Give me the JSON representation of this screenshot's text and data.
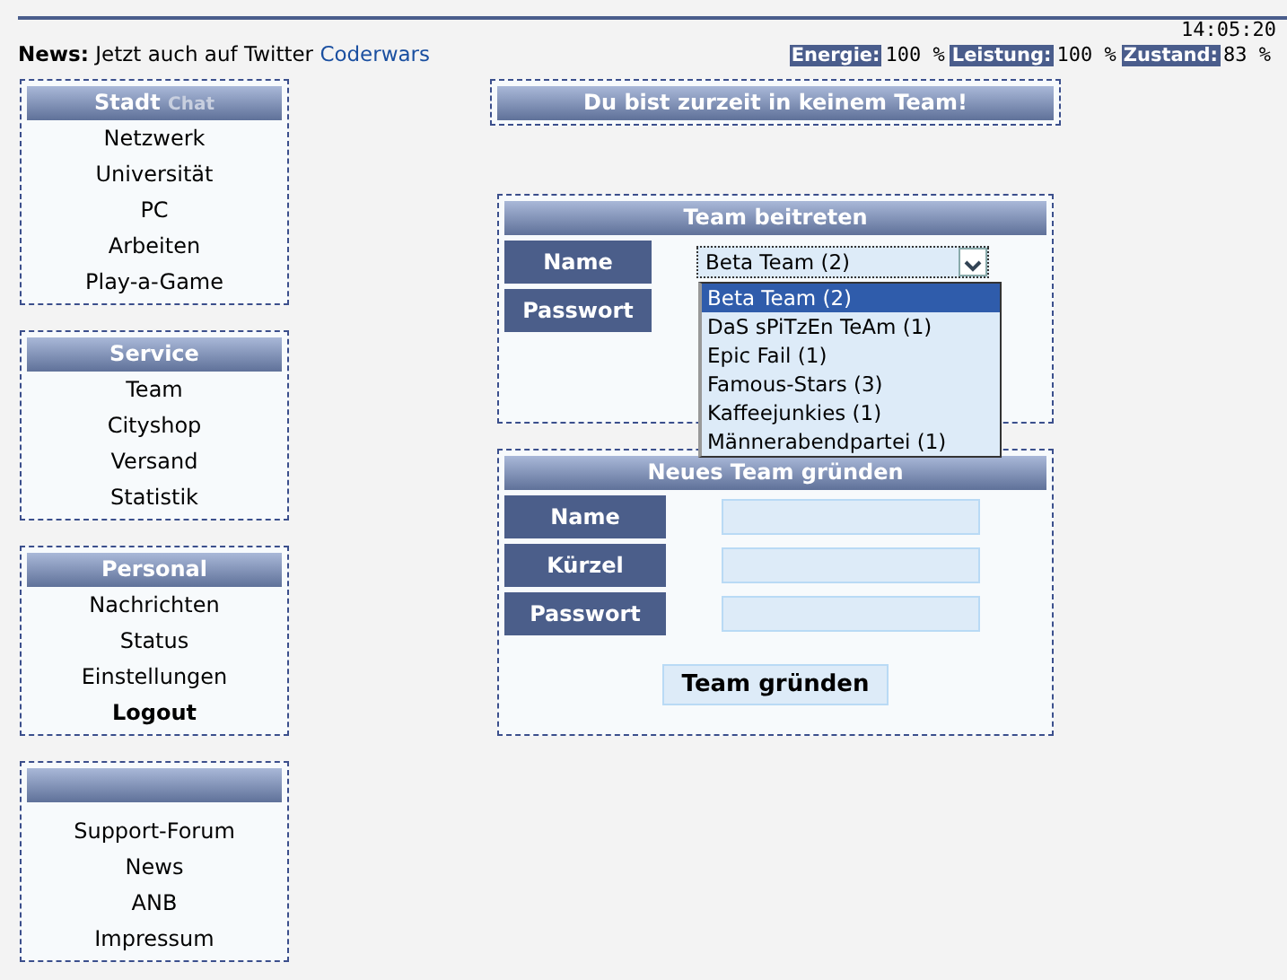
{
  "clock": "14:05:20",
  "news": {
    "label": "News:",
    "text": "Jetzt auch auf Twitter",
    "link": "Coderwars"
  },
  "stats": [
    {
      "label": "Energie:",
      "value": "100 %"
    },
    {
      "label": "Leistung:",
      "value": "100 %"
    },
    {
      "label": "Zustand:",
      "value": "83 %"
    }
  ],
  "sidebar": [
    {
      "title": "Stadt",
      "title_extra": "Chat",
      "items": [
        {
          "label": "Netzwerk",
          "bold": false
        },
        {
          "label": "Universität",
          "bold": false
        },
        {
          "label": "PC",
          "bold": false
        },
        {
          "label": "Arbeiten",
          "bold": false
        },
        {
          "label": "Play-a-Game",
          "bold": false
        }
      ]
    },
    {
      "title": "Service",
      "items": [
        {
          "label": "Team",
          "bold": false
        },
        {
          "label": "Cityshop",
          "bold": false
        },
        {
          "label": "Versand",
          "bold": false
        },
        {
          "label": "Statistik",
          "bold": false
        }
      ]
    },
    {
      "title": "Personal",
      "items": [
        {
          "label": "Nachrichten",
          "bold": false
        },
        {
          "label": "Status",
          "bold": false
        },
        {
          "label": "Einstellungen",
          "bold": false
        },
        {
          "label": "Logout",
          "bold": true
        }
      ]
    },
    {
      "items": [
        {
          "label": "Support-Forum",
          "bold": false
        },
        {
          "label": "News",
          "bold": false
        },
        {
          "label": "ANB",
          "bold": false
        },
        {
          "label": "Impressum",
          "bold": false
        }
      ]
    }
  ],
  "status_heading": "Du bist zurzeit in keinem Team!",
  "join": {
    "title": "Team beitreten",
    "name_label": "Name",
    "password_label": "Passwort",
    "team_select": {
      "value": "Beta Team (2)",
      "expanded": true,
      "options": [
        {
          "label": "Beta Team (2)",
          "selected": true
        },
        {
          "label": "DaS sPiTzEn TeAm (1)",
          "selected": false
        },
        {
          "label": "Epic Fail (1)",
          "selected": false
        },
        {
          "label": "Famous-Stars (3)",
          "selected": false
        },
        {
          "label": "Kaffeejunkies (1)",
          "selected": false
        },
        {
          "label": "Männerabendpartei (1)",
          "selected": false
        }
      ]
    }
  },
  "create": {
    "title": "Neues Team gründen",
    "fields": [
      {
        "label": "Name"
      },
      {
        "label": "Kürzel"
      },
      {
        "label": "Passwort"
      }
    ],
    "button": "Team gründen"
  }
}
